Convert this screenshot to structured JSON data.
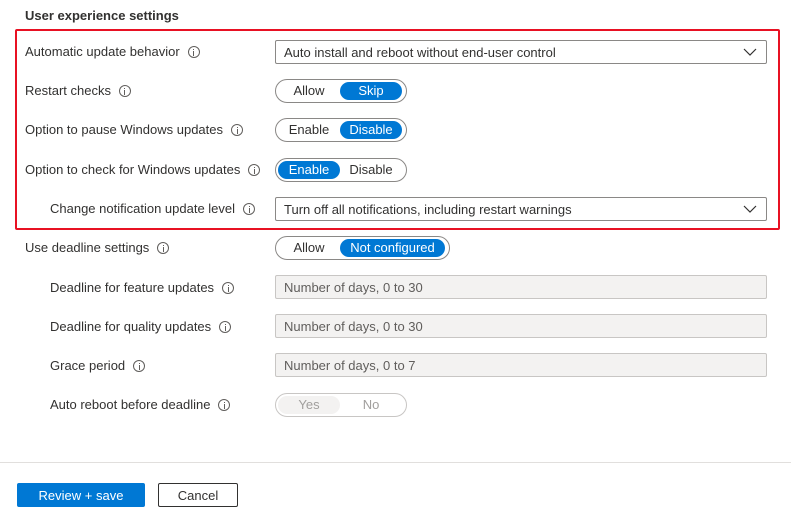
{
  "section_title": "User experience settings",
  "settings": {
    "auto_update_behavior": {
      "label": "Automatic update behavior",
      "value": "Auto install and reboot without end-user control"
    },
    "restart_checks": {
      "label": "Restart checks",
      "options": [
        "Allow",
        "Skip"
      ],
      "selected": "Skip"
    },
    "pause_updates": {
      "label": "Option to pause Windows updates",
      "options": [
        "Enable",
        "Disable"
      ],
      "selected": "Disable"
    },
    "check_updates": {
      "label": "Option to check for Windows updates",
      "options": [
        "Enable",
        "Disable"
      ],
      "selected": "Enable"
    },
    "notification_level": {
      "label": "Change notification update level",
      "value": "Turn off all notifications, including restart warnings"
    },
    "deadline_settings": {
      "label": "Use deadline settings",
      "options": [
        "Allow",
        "Not configured"
      ],
      "selected": "Not configured"
    },
    "deadline_feature": {
      "label": "Deadline for feature updates",
      "placeholder": "Number of days, 0 to 30"
    },
    "deadline_quality": {
      "label": "Deadline for quality updates",
      "placeholder": "Number of days, 0 to 30"
    },
    "grace_period": {
      "label": "Grace period",
      "placeholder": "Number of days, 0 to 7"
    },
    "auto_reboot": {
      "label": "Auto reboot before deadline",
      "options": [
        "Yes",
        "No"
      ],
      "selected": "Yes"
    }
  },
  "footer": {
    "review_save_label": "Review + save",
    "cancel_label": "Cancel"
  },
  "colors": {
    "accent": "#0078d4",
    "highlight_border": "#e81123",
    "text": "#323130",
    "disabled_bg": "#f3f2f1"
  }
}
